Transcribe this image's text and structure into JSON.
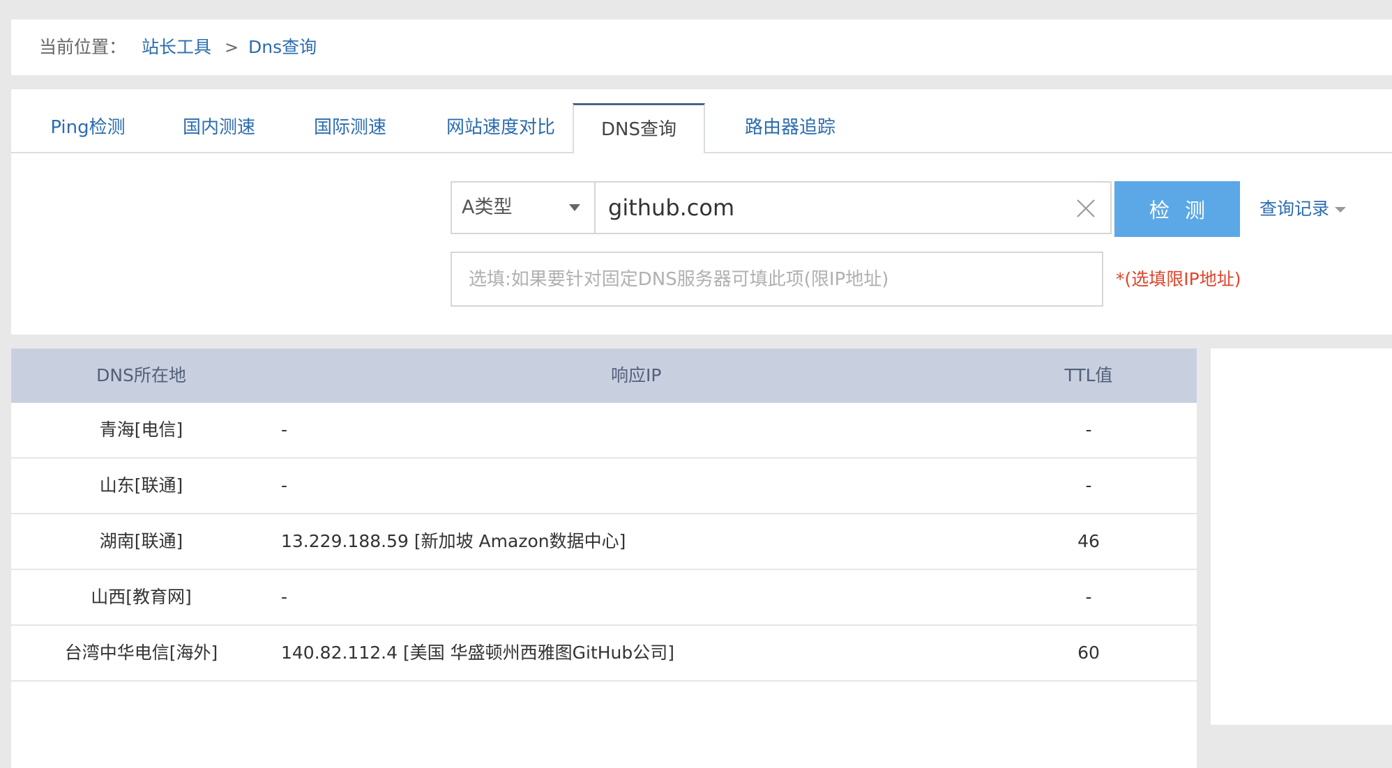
{
  "breadcrumb": {
    "prefix": "当前位置：",
    "items": [
      "站长工具",
      "Dns查询"
    ],
    "separator": ">"
  },
  "tabs": [
    {
      "label": "Ping检测",
      "active": false
    },
    {
      "label": "国内测速",
      "active": false
    },
    {
      "label": "国际测速",
      "active": false
    },
    {
      "label": "网站速度对比",
      "active": false
    },
    {
      "label": "DNS查询",
      "active": true
    },
    {
      "label": "路由器追踪",
      "active": false
    }
  ],
  "query": {
    "record_type": "A类型",
    "domain_value": "github.com",
    "check_label": "检测",
    "history_label": "查询记录",
    "dns_server_placeholder": "选填:如果要针对固定DNS服务器可填此项(限IP地址)",
    "dns_server_note": "*(选填限IP地址)"
  },
  "results": {
    "headers": [
      "DNS所在地",
      "响应IP",
      "TTL值"
    ],
    "rows": [
      {
        "location": "青海[电信]",
        "ip": "-",
        "ttl": "-"
      },
      {
        "location": "山东[联通]",
        "ip": "-",
        "ttl": "-"
      },
      {
        "location": "湖南[联通]",
        "ip": "13.229.188.59 [新加坡 Amazon数据中心]",
        "ttl": "46"
      },
      {
        "location": "山西[教育网]",
        "ip": "-",
        "ttl": "-"
      },
      {
        "location": "台湾中华电信[海外]",
        "ip": "140.82.112.4 [美国 华盛顿州西雅图GitHub公司]",
        "ttl": "60"
      }
    ]
  },
  "colors": {
    "link": "#2b6cb0",
    "primary_button": "#5ca8e6",
    "table_header": "#c8d0e0",
    "note": "#e0452b",
    "active_tab_border": "#4c6287"
  }
}
